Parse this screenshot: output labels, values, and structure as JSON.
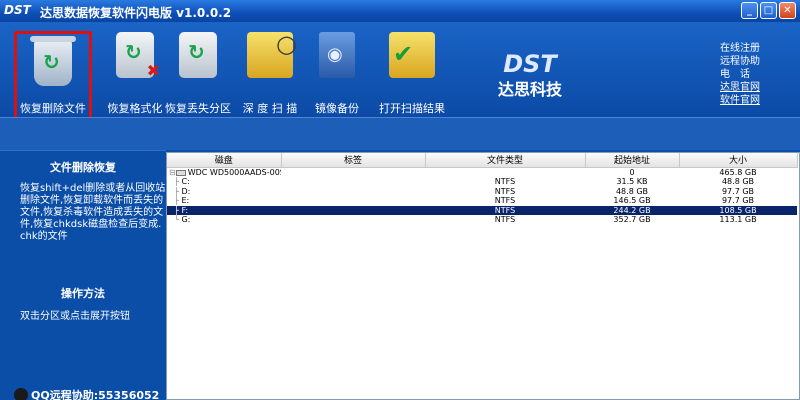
{
  "window": {
    "logo": "DST",
    "title": "达思数据恢复软件闪电版 v1.0.0.2",
    "buttons": {
      "min": "_",
      "max": "□",
      "close": "✕"
    }
  },
  "toolbar": {
    "items": [
      {
        "label": "恢复删除文件",
        "icon": "trash-recover-icon"
      },
      {
        "label": "恢复格式化",
        "icon": "drive-format-icon"
      },
      {
        "label": "恢复丢失分区",
        "icon": "drive-partition-icon"
      },
      {
        "label": "深 度 扫 描",
        "icon": "magnifier-folder-icon"
      },
      {
        "label": "镜像备份",
        "icon": "image-backup-icon"
      },
      {
        "label": "打开扫描结果",
        "icon": "open-folder-icon"
      }
    ]
  },
  "brand": {
    "mark": "DST",
    "name": "达思科技"
  },
  "links": [
    "在线注册",
    "远程协助",
    "电　话",
    "达思官网",
    "软件官网"
  ],
  "left_panel": {
    "title": "文件删除恢复",
    "description": "恢复shift+del删除或者从回收站删除文件,恢复卸载软件而丢失的文件,恢复杀毒软件造成丢失的文件,恢复chkdsk磁盘检查后变成.chk的文件",
    "method_title": "操作方法",
    "method_text": "双击分区或点击展开按钮",
    "qq": "QQ远程协助:55356052"
  },
  "table": {
    "headers": [
      "磁盘",
      "标签",
      "文件类型",
      "起始地址",
      "大小"
    ],
    "rows": [
      {
        "disk": "WDC WD5000AADS-00S...",
        "label": "",
        "type": "",
        "start": "0",
        "size": "465.8 GB",
        "root": true,
        "selected": false
      },
      {
        "disk": "C:",
        "label": "",
        "type": "NTFS",
        "start": "31.5 KB",
        "size": "48.8 GB",
        "root": false,
        "selected": false
      },
      {
        "disk": "D:",
        "label": "",
        "type": "NTFS",
        "start": "48.8 GB",
        "size": "97.7 GB",
        "root": false,
        "selected": false
      },
      {
        "disk": "E:",
        "label": "",
        "type": "NTFS",
        "start": "146.5 GB",
        "size": "97.7 GB",
        "root": false,
        "selected": false
      },
      {
        "disk": "F:",
        "label": "",
        "type": "NTFS",
        "start": "244.2 GB",
        "size": "108.5 GB",
        "root": false,
        "selected": true
      },
      {
        "disk": "G:",
        "label": "",
        "type": "NTFS",
        "start": "352.7 GB",
        "size": "113.1 GB",
        "root": false,
        "selected": false
      }
    ]
  }
}
